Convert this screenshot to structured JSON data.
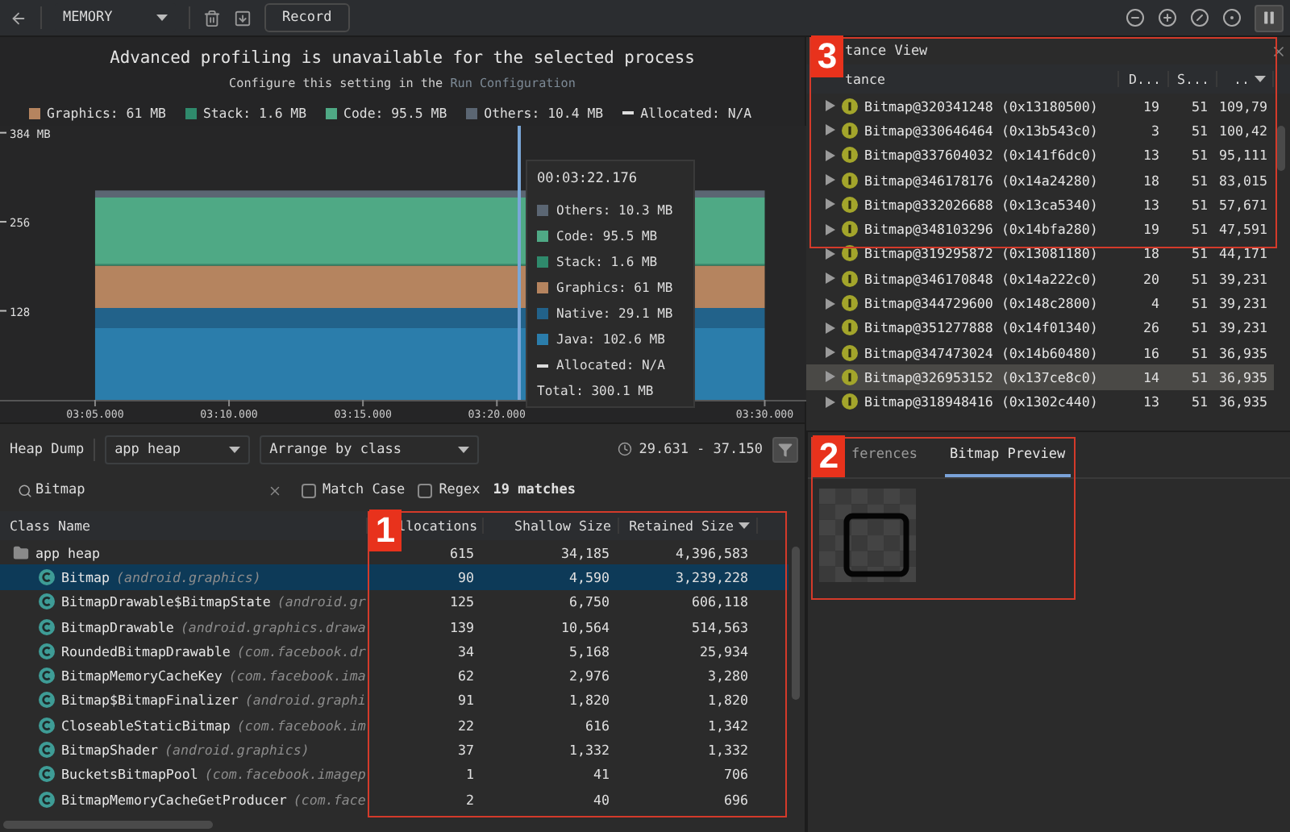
{
  "toolbar": {
    "profiler": "MEMORY",
    "record_button": "Record"
  },
  "banner": {
    "title": "Advanced profiling is unavailable for the selected process",
    "text": "Configure this setting in the ",
    "link": "Run Configuration"
  },
  "memory_chart": {
    "legend": [
      {
        "kind": "swatch",
        "label": "Graphics: 61 MB",
        "color": "#b5845f"
      },
      {
        "kind": "swatch",
        "label": "Stack: 1.6 MB",
        "color": "#2f8a6c"
      },
      {
        "kind": "swatch",
        "label": "Code: 95.5 MB",
        "color": "#4fa985"
      },
      {
        "kind": "swatch",
        "label": "Others: 10.4 MB",
        "color": "#5b6673"
      },
      {
        "kind": "dash",
        "label": "Allocated: N/A"
      }
    ],
    "chart_data": {
      "type": "area",
      "stacked": true,
      "categories": [
        "03:05.000",
        "03:10.000",
        "03:15.000",
        "03:20.000",
        null,
        "03:30.000"
      ],
      "series": [
        {
          "name": "Java: 102.6 MB",
          "color": "#2b7dab",
          "values": [
            103,
            103,
            103,
            103,
            null,
            103
          ]
        },
        {
          "name": "Native: 29.1 MB",
          "color": "#22628a",
          "values": [
            29,
            29,
            29,
            29,
            null,
            29
          ]
        },
        {
          "name": "Graphics: 61 MB",
          "color": "#b5845f",
          "values": [
            61,
            61,
            61,
            61,
            null,
            61
          ]
        },
        {
          "name": "Stack: 1.6 MB",
          "color": "#2f8a6c",
          "values": [
            2,
            2,
            2,
            2,
            null,
            2
          ]
        },
        {
          "name": "Code: 95.5 MB",
          "color": "#4fa985",
          "values": [
            96,
            96,
            96,
            96,
            null,
            96
          ]
        },
        {
          "name": "Others: 10.3 MB",
          "color": "#5b6673",
          "values": [
            10,
            10,
            10,
            10,
            null,
            10
          ]
        }
      ],
      "ylim": [
        0,
        394
      ],
      "yticks": [
        {
          "value": 128,
          "label": "128"
        },
        {
          "value": 256,
          "label": "256"
        },
        {
          "value": 384,
          "label": "384 MB"
        }
      ]
    },
    "tooltip": {
      "time": "00:03:22.176",
      "entries": [
        {
          "kind": "dash",
          "label": "Allocated: N/A"
        },
        {
          "kind": "total",
          "label": "Total: 300.1 MB"
        }
      ]
    }
  },
  "heap_dump": {
    "label": "Heap Dump",
    "heap_select": "app heap",
    "arrange_select": "Arrange by class",
    "time_range": "29.631 - 37.150",
    "search": {
      "value": "Bitmap"
    },
    "options": [
      {
        "label": "Match Case",
        "checked": false
      },
      {
        "label": "Regex",
        "checked": false
      }
    ],
    "match_count": "19 matches",
    "annotation": "1",
    "columns": [
      "Class Name",
      "llocations",
      "Shallow Size",
      "Retained Size"
    ],
    "tree": {
      "name": "app heap",
      "allocations": "615",
      "shallow": "34,185",
      "retained": "4,396,583",
      "selected": false,
      "children": [
        {
          "name": "Bitmap",
          "package": "(android.graphics)",
          "allocations": "90",
          "shallow": "4,590",
          "retained": "3,239,228",
          "selected": true
        },
        {
          "name": "BitmapDrawable$BitmapState",
          "package": "(android.gr",
          "allocations": "125",
          "shallow": "6,750",
          "retained": "606,118",
          "selected": false
        },
        {
          "name": "BitmapDrawable",
          "package": "(android.graphics.drawa",
          "allocations": "139",
          "shallow": "10,564",
          "retained": "514,563",
          "selected": false
        },
        {
          "name": "RoundedBitmapDrawable",
          "package": "(com.facebook.dr",
          "allocations": "34",
          "shallow": "5,168",
          "retained": "25,934",
          "selected": false
        },
        {
          "name": "BitmapMemoryCacheKey",
          "package": "(com.facebook.ima",
          "allocations": "62",
          "shallow": "2,976",
          "retained": "3,280",
          "selected": false
        },
        {
          "name": "Bitmap$BitmapFinalizer",
          "package": "(android.graphi",
          "allocations": "91",
          "shallow": "1,820",
          "retained": "1,820",
          "selected": false
        },
        {
          "name": "CloseableStaticBitmap",
          "package": "(com.facebook.im",
          "allocations": "22",
          "shallow": "616",
          "retained": "1,342",
          "selected": false
        },
        {
          "name": "BitmapShader",
          "package": "(android.graphics)",
          "allocations": "37",
          "shallow": "1,332",
          "retained": "1,332",
          "selected": false
        },
        {
          "name": "BucketsBitmapPool",
          "package": "(com.facebook.imagep",
          "allocations": "1",
          "shallow": "41",
          "retained": "706",
          "selected": false
        },
        {
          "name": "BitmapMemoryCacheGetProducer",
          "package": "(com.face",
          "allocations": "2",
          "shallow": "40",
          "retained": "696",
          "selected": false
        }
      ]
    }
  },
  "instance_view": {
    "title": "tance View",
    "annotation": "3",
    "columns": [
      "tance",
      "D...",
      "S...",
      ".."
    ],
    "rows": [
      {
        "name": "Bitmap@320341248",
        "address": "(0x13180500)",
        "depth": "19",
        "shallow": "51",
        "retained": "109,79",
        "selected": false
      },
      {
        "name": "Bitmap@330646464",
        "address": "(0x13b543c0)",
        "depth": "3",
        "shallow": "51",
        "retained": "100,42",
        "selected": false
      },
      {
        "name": "Bitmap@337604032",
        "address": "(0x141f6dc0)",
        "depth": "13",
        "shallow": "51",
        "retained": "95,111",
        "selected": false
      },
      {
        "name": "Bitmap@346178176",
        "address": "(0x14a24280)",
        "depth": "18",
        "shallow": "51",
        "retained": "83,015",
        "selected": false
      },
      {
        "name": "Bitmap@332026688",
        "address": "(0x13ca5340)",
        "depth": "13",
        "shallow": "51",
        "retained": "57,671",
        "selected": false
      },
      {
        "name": "Bitmap@348103296",
        "address": "(0x14bfa280)",
        "depth": "19",
        "shallow": "51",
        "retained": "47,591",
        "selected": false
      },
      {
        "name": "Bitmap@319295872",
        "address": "(0x13081180)",
        "depth": "18",
        "shallow": "51",
        "retained": "44,171",
        "selected": false
      },
      {
        "name": "Bitmap@346170848",
        "address": "(0x14a222c0)",
        "depth": "20",
        "shallow": "51",
        "retained": "39,231",
        "selected": false
      },
      {
        "name": "Bitmap@344729600",
        "address": "(0x148c2800)",
        "depth": "4",
        "shallow": "51",
        "retained": "39,231",
        "selected": false
      },
      {
        "name": "Bitmap@351277888",
        "address": "(0x14f01340)",
        "depth": "26",
        "shallow": "51",
        "retained": "39,231",
        "selected": false
      },
      {
        "name": "Bitmap@347473024",
        "address": "(0x14b60480)",
        "depth": "16",
        "shallow": "51",
        "retained": "36,935",
        "selected": false
      },
      {
        "name": "Bitmap@326953152",
        "address": "(0x137ce8c0)",
        "depth": "14",
        "shallow": "51",
        "retained": "36,935",
        "selected": true
      },
      {
        "name": "Bitmap@318948416",
        "address": "(0x1302c440)",
        "depth": "13",
        "shallow": "51",
        "retained": "36,935",
        "selected": false
      }
    ]
  },
  "detail_panel": {
    "annotation": "2",
    "tabs": [
      {
        "label": "ferences",
        "selected": false
      },
      {
        "label": "Bitmap Preview",
        "selected": true
      }
    ]
  }
}
